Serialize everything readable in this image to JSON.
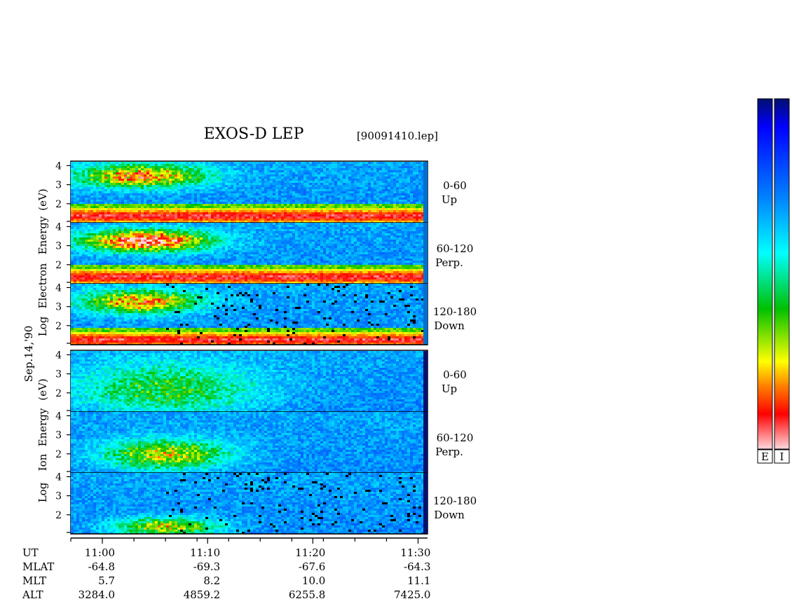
{
  "chart_data": {
    "type": "heatmap",
    "title": "EXOS-D LEP",
    "file_label": "[90091410.lep]",
    "date_label": "Sep.14,'90",
    "electron_ylabel": [
      "Log",
      "Electron",
      "Energy",
      "(eV)"
    ],
    "ion_ylabel": [
      "Log",
      "Ion",
      "Energy",
      "(eV)"
    ],
    "y_ticks": [
      "4",
      "3",
      "2"
    ],
    "y_tick_values": [
      4,
      3,
      2
    ],
    "ylim": [
      1,
      4.2
    ],
    "x_ticks": [
      "11:00",
      "11:10",
      "11:20",
      "11:30"
    ],
    "x_tick_minutes": [
      0,
      10,
      20,
      30
    ],
    "xlim_minutes": [
      -3,
      30.5
    ],
    "panels": [
      {
        "group": "electron",
        "pitch": "0-60",
        "direction": "Up",
        "line_energy_log": 1.4,
        "cloud": {
          "center": [
            3.5,
            3.5
          ],
          "spread": [
            6,
            0.6
          ],
          "strength": 0.55
        },
        "dropout": 0.0
      },
      {
        "group": "electron",
        "pitch": "60-120",
        "direction": "Perp.",
        "line_energy_log": 1.4,
        "cloud": {
          "center": [
            4,
            3.3
          ],
          "spread": [
            6,
            0.55
          ],
          "strength": 0.7
        },
        "dropout": 0.0
      },
      {
        "group": "electron",
        "pitch": "120-180",
        "direction": "Down",
        "line_energy_log": 1.3,
        "cloud": {
          "center": [
            3.5,
            3.3
          ],
          "spread": [
            5.5,
            0.6
          ],
          "strength": 0.55
        },
        "dropout": 0.05
      },
      {
        "group": "ion",
        "pitch": "0-60",
        "direction": "Up",
        "line_energy_log": null,
        "cloud": {
          "center": [
            6,
            2.2
          ],
          "spread": [
            9,
            1.4
          ],
          "strength": 0.3
        },
        "dropout": 0.0
      },
      {
        "group": "ion",
        "pitch": "60-120",
        "direction": "Perp.",
        "line_energy_log": null,
        "cloud": {
          "center": [
            6,
            2.0
          ],
          "spread": [
            6,
            0.8
          ],
          "strength": 0.45
        },
        "dropout": 0.0
      },
      {
        "group": "ion",
        "pitch": "120-180",
        "direction": "Down",
        "line_energy_log": null,
        "cloud": {
          "center": [
            6,
            1.4
          ],
          "spread": [
            5,
            0.5
          ],
          "strength": 0.45
        },
        "dropout": 0.05
      }
    ],
    "orbit": {
      "labels": [
        "UT",
        "MLAT",
        "MLT",
        "ALT"
      ],
      "values": [
        [
          "11:00",
          "11:10",
          "11:20",
          "11:30"
        ],
        [
          "-64.8",
          "-69.3",
          "-67.6",
          "-64.3"
        ],
        [
          "5.7",
          "8.2",
          "10.0",
          "11.1"
        ],
        [
          "3284.0",
          "4859.2",
          "6255.8",
          "7425.0"
        ]
      ]
    },
    "colorbar": {
      "labels": [
        "E",
        "I"
      ],
      "colors": [
        "#001070",
        "#0000ff",
        "#0080ff",
        "#00ffff",
        "#00c000",
        "#ffff00",
        "#ff8000",
        "#ff0000",
        "#ffd8dc"
      ],
      "stops": [
        0.0,
        0.08,
        0.28,
        0.44,
        0.6,
        0.75,
        0.82,
        0.9,
        1.0
      ]
    },
    "grid": false
  }
}
